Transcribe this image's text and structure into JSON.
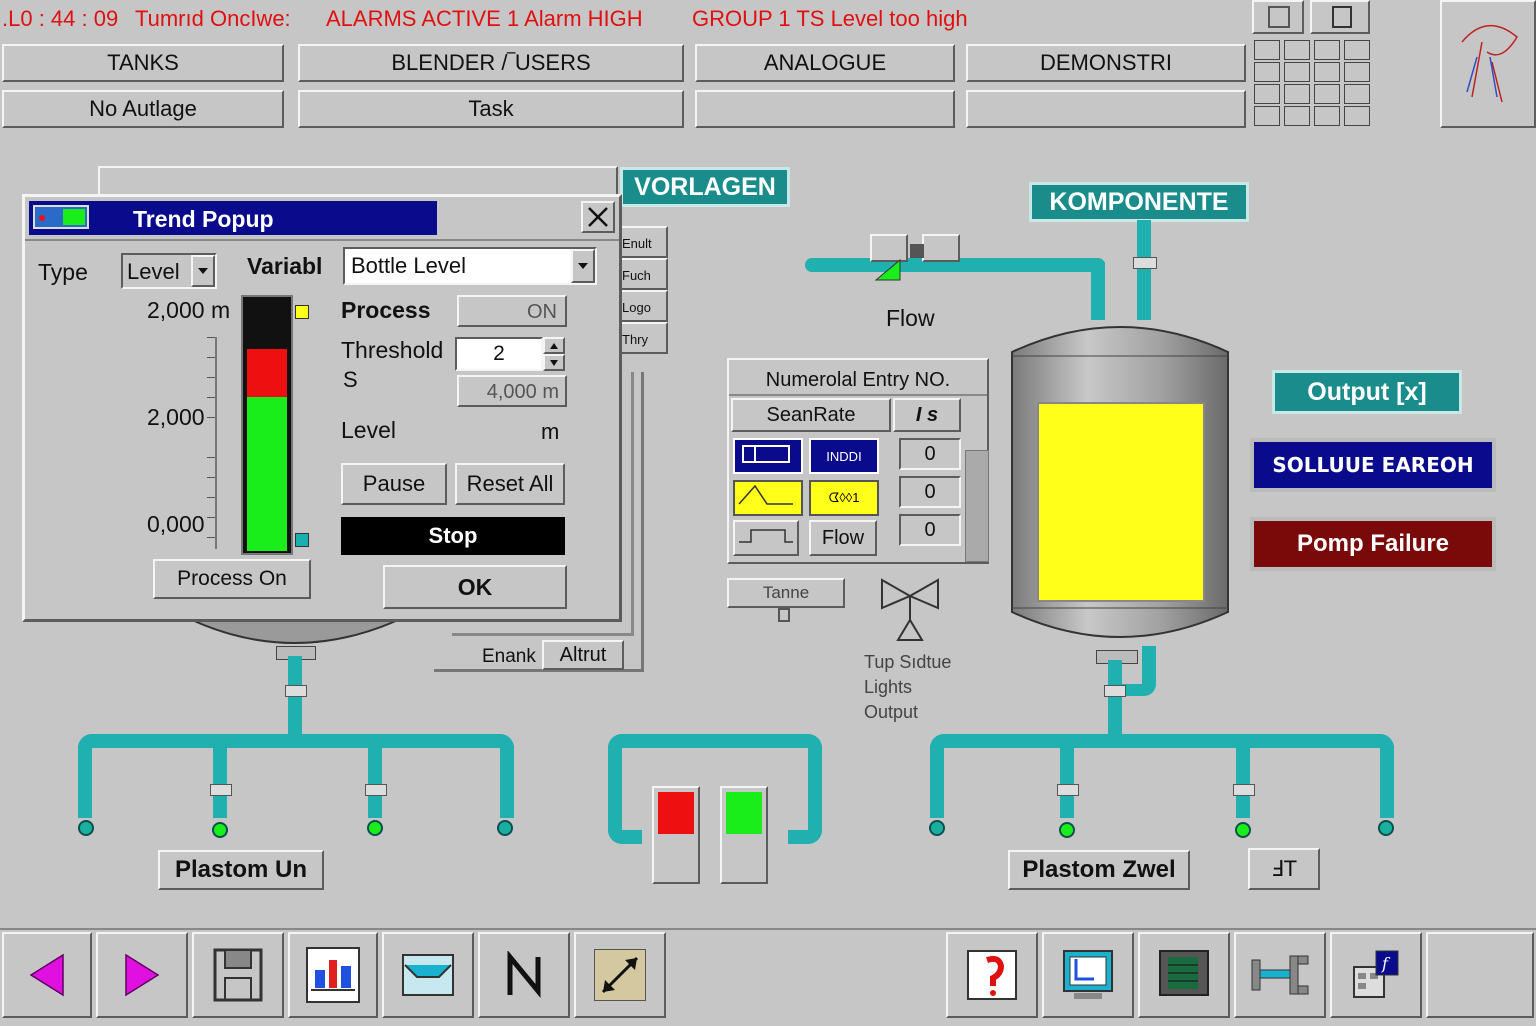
{
  "alarm_bar": {
    "time": ".L0 : 44 : 09",
    "prefix": "Tumrıd OncIwe:",
    "message": "ALARMS  ACTIVE  1  Alarm  HIGH",
    "group": "GROUP  1  TS  Level  too  high"
  },
  "nav": {
    "tanks": "TANKS",
    "blender": "BLENDER  /‾USERS",
    "analogue": "ANALOGUE",
    "demo": "DEMONSTRI",
    "sub1": "No  Autlage",
    "sub2": "Task",
    "sub3": "",
    "sub4": ""
  },
  "labels": {
    "vorlagen": "VORLAGEN",
    "komponente": "KOMPONENTE",
    "flow": "Flow",
    "output": "Output [x]",
    "solution": "SOLLUUE EAREOH",
    "pump_failure": "Pomp Failure",
    "plastom_un": "Plastom Un",
    "plastom_zwei": "Plastom Zwel",
    "small_btn": "ℲT",
    "tanne": "Tanne",
    "valve_caption": [
      "Tup Sıdtue",
      "Lights",
      "Output"
    ],
    "enank": "Enank",
    "altrut": "Altrut",
    "bg_list": [
      "Enult",
      "Fuch",
      "Logo",
      "Thry"
    ]
  },
  "numeric_entry": {
    "title": "Numerolal Entry NO.",
    "col1": "SeanRate",
    "col2": "I s",
    "values": [
      "0",
      "0",
      "0"
    ],
    "flow_btn": "Flow",
    "btn_text": "INDDI",
    "btn_text2": "ᗧ◊◊1"
  },
  "popup": {
    "title": "Trend Popup",
    "type_label": "Type",
    "type_value": "Level",
    "var_label": "Variabl",
    "var_value": "Bottle Level",
    "scale": [
      "2,000 m",
      "2,000",
      "0,000"
    ],
    "process_label": "Process",
    "process_value": "ON",
    "threshold_label": "Threshold",
    "threshold_value": "2",
    "s_label": "S",
    "s_value": "4,000 m",
    "level_label": "Level",
    "level_unit": "m",
    "pause": "Pause",
    "reset": "Reset All",
    "stop": "Stop",
    "process_on": "Process On",
    "ok": "OK",
    "bar_level": 0.61
  },
  "colors": {
    "alarm_text": "#e01010",
    "teal": "#1a8c8c",
    "pipe": "#20b0b0",
    "navy": "#0a0a8c",
    "yellow": "#ffff1a",
    "green": "#1aee1a",
    "red": "#ee1010",
    "maroon": "#7a0a0a"
  }
}
